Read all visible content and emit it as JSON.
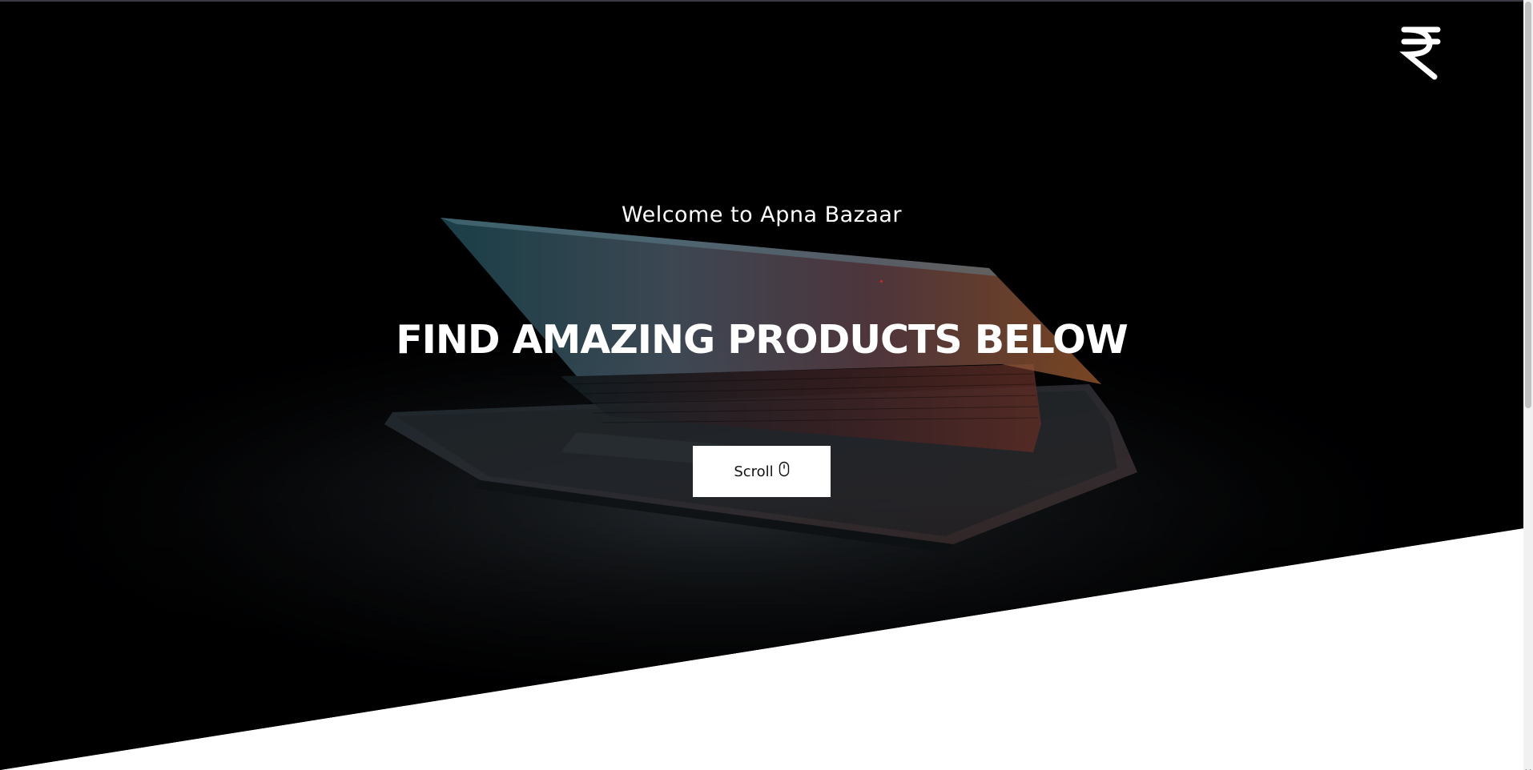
{
  "hero": {
    "welcome_text": "Welcome to Apna Bazaar",
    "headline": "FIND AMAZING PRODUCTS BELOW",
    "scroll_label": "Scroll"
  },
  "logo": {
    "icon": "rupee-icon",
    "glyph": "₹"
  },
  "icons": {
    "scroll_button": "mouse-icon"
  },
  "colors": {
    "hero_background": "#010102",
    "text": "#ffffff",
    "button_background": "#ffffff",
    "button_text": "#111111",
    "page_background": "#ffffff"
  }
}
